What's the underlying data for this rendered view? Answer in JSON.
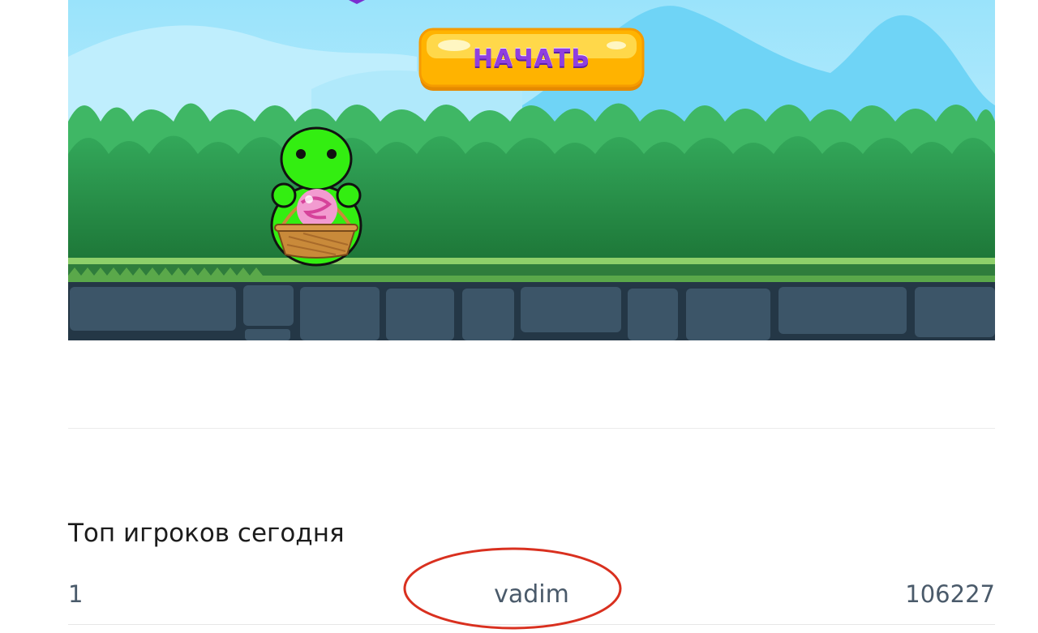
{
  "game": {
    "start_button_label": "НАЧАТЬ"
  },
  "leaderboard": {
    "title": "Топ игроков сегодня",
    "rows": [
      {
        "rank": "1",
        "name": "vadim",
        "score": "106227"
      }
    ]
  },
  "colors": {
    "sky": "#8fdcf7",
    "bush_dark": "#1f7a3a",
    "bush_light": "#33a85a",
    "grass": "#8ed06a",
    "stone": "#3c5568",
    "stone_grout": "#243746",
    "character": "#33ee11",
    "button_gold": "#ffb300",
    "button_text": "#8f3fe0",
    "annotation": "#d9301f"
  },
  "icons": [
    "player-character-icon",
    "candy-ball-icon",
    "basket-icon"
  ]
}
